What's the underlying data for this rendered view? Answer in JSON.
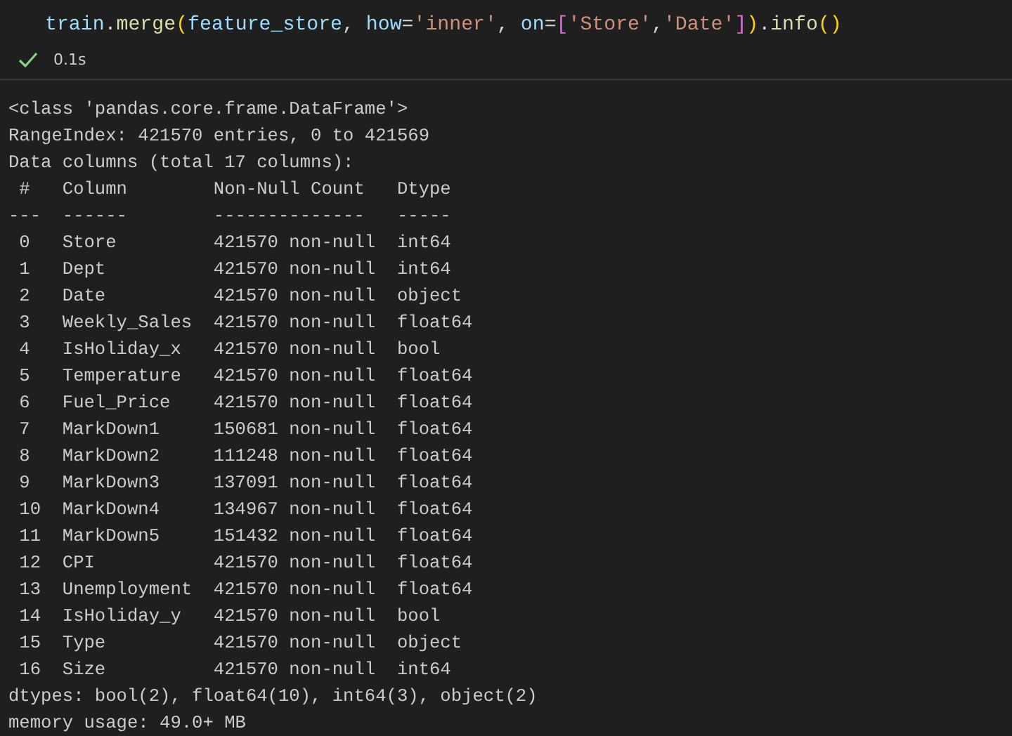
{
  "code_cell": {
    "tokens": [
      {
        "kind": "var",
        "text": "train"
      },
      {
        "kind": "punct",
        "text": "."
      },
      {
        "kind": "func",
        "text": "merge"
      },
      {
        "kind": "bracket1",
        "text": "("
      },
      {
        "kind": "var",
        "text": "feature_store"
      },
      {
        "kind": "punct",
        "text": ", "
      },
      {
        "kind": "var",
        "text": "how"
      },
      {
        "kind": "punct",
        "text": "="
      },
      {
        "kind": "string",
        "text": "'inner'"
      },
      {
        "kind": "punct",
        "text": ", "
      },
      {
        "kind": "var",
        "text": "on"
      },
      {
        "kind": "punct",
        "text": "="
      },
      {
        "kind": "bracket2",
        "text": "["
      },
      {
        "kind": "string",
        "text": "'Store'"
      },
      {
        "kind": "punct",
        "text": ","
      },
      {
        "kind": "string",
        "text": "'Date'"
      },
      {
        "kind": "bracket2",
        "text": "]"
      },
      {
        "kind": "bracket1",
        "text": ")"
      },
      {
        "kind": "punct",
        "text": "."
      },
      {
        "kind": "func",
        "text": "info"
      },
      {
        "kind": "bracket1",
        "text": "()"
      }
    ],
    "status": {
      "succeeded": true,
      "duration": "0.1s"
    }
  },
  "output_lines": [
    "<class 'pandas.core.frame.DataFrame'>",
    "RangeIndex: 421570 entries, 0 to 421569",
    "Data columns (total 17 columns):",
    " #   Column        Non-Null Count   Dtype",
    "---  ------        --------------   -----",
    " 0   Store         421570 non-null  int64",
    " 1   Dept          421570 non-null  int64",
    " 2   Date          421570 non-null  object",
    " 3   Weekly_Sales  421570 non-null  float64",
    " 4   IsHoliday_x   421570 non-null  bool",
    " 5   Temperature   421570 non-null  float64",
    " 6   Fuel_Price    421570 non-null  float64",
    " 7   MarkDown1     150681 non-null  float64",
    " 8   MarkDown2     111248 non-null  float64",
    " 9   MarkDown3     137091 non-null  float64",
    " 10  MarkDown4     134967 non-null  float64",
    " 11  MarkDown5     151432 non-null  float64",
    " 12  CPI           421570 non-null  float64",
    " 13  Unemployment  421570 non-null  float64",
    " 14  IsHoliday_y   421570 non-null  bool",
    " 15  Type          421570 non-null  object",
    " 16  Size          421570 non-null  int64",
    "dtypes: bool(2), float64(10), int64(3), object(2)",
    "memory usage: 49.0+ MB"
  ]
}
